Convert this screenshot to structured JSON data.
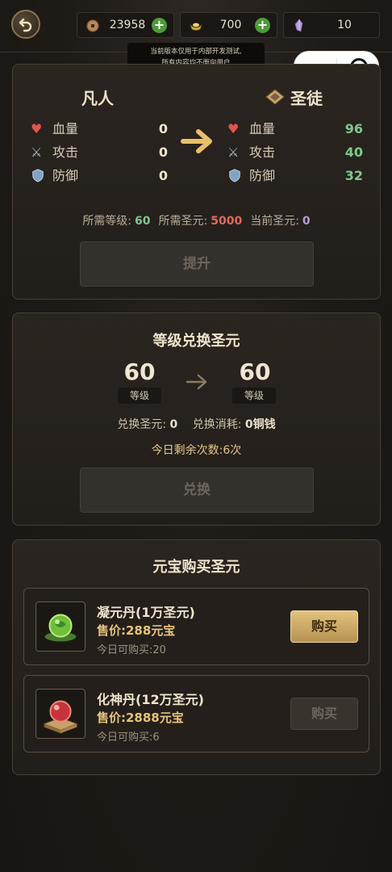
{
  "header": {
    "copper": "23958",
    "gold": "700",
    "crystal": "10",
    "tip_line1": "当前版本仅用于内部开发测试,",
    "tip_line2": "所有内容均不面向用户"
  },
  "promotion": {
    "current_rank": "凡人",
    "next_rank": "圣徒",
    "current_stats": [
      {
        "label": "血量",
        "value": "0"
      },
      {
        "label": "攻击",
        "value": "0"
      },
      {
        "label": "防御",
        "value": "0"
      }
    ],
    "next_stats": [
      {
        "label": "血量",
        "value": "96"
      },
      {
        "label": "攻击",
        "value": "40"
      },
      {
        "label": "防御",
        "value": "32"
      }
    ],
    "req_level_label": "所需等级:",
    "req_level": "60",
    "req_essence_label": "所需圣元:",
    "req_essence": "5000",
    "cur_essence_label": "当前圣元:",
    "cur_essence": "0",
    "button": "提升"
  },
  "exchange": {
    "title": "等级兑换圣元",
    "from_level": "60",
    "to_level": "60",
    "level_tag": "等级",
    "essence_label": "兑换圣元:",
    "essence_value": "0",
    "cost_label": "兑换消耗:",
    "cost_value": "0铜钱",
    "remaining": "今日剩余次数:6次",
    "button": "兑换"
  },
  "shop": {
    "title": "元宝购买圣元",
    "items": [
      {
        "name": "凝元丹(1万圣元)",
        "price": "售价:288元宝",
        "limit": "今日可购买:20",
        "button": "购买"
      },
      {
        "name": "化神丹(12万圣元)",
        "price": "售价:2888元宝",
        "limit": "今日可购买:6",
        "button": "购买"
      }
    ]
  },
  "colors": {
    "accent_gold": "#e8c06a",
    "stat_green": "#7ec98a",
    "essence_red": "#e06a5a",
    "essence_purple": "#b59ad8"
  }
}
